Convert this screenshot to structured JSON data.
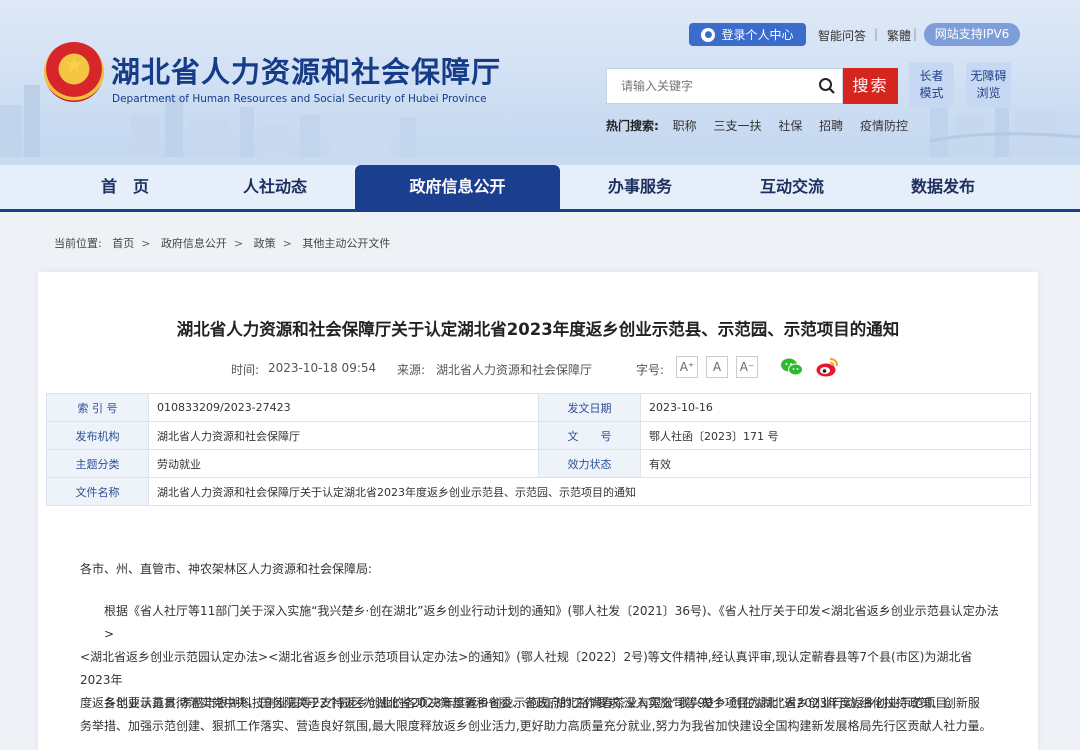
{
  "header": {
    "site_title": "湖北省人力资源和社会保障厅",
    "site_subtitle": "Department of Human Resources and Social Security of Hubei Province",
    "login_label": "登录个人中心",
    "qa_label": "智能问答",
    "trad_label": "繁體",
    "ipv6_label": "网站支持IPV6",
    "search_placeholder": "请输入关键字",
    "search_button": "搜索",
    "elder_mode": [
      "长者",
      "模式"
    ],
    "accessible_mode": [
      "无障碍",
      "浏览"
    ],
    "hot_label": "热门搜索:",
    "hot_terms": [
      "职称",
      "三支一扶",
      "社保",
      "招聘",
      "疫情防控"
    ]
  },
  "nav": {
    "items": [
      "首　页",
      "人社动态",
      "政府信息公开",
      "办事服务",
      "互动交流",
      "数据发布"
    ],
    "active_index": 2
  },
  "breadcrumb": {
    "label": "当前位置:",
    "items": [
      "首页",
      "政府信息公开",
      "政策",
      "其他主动公开文件"
    ]
  },
  "article": {
    "title": "湖北省人力资源和社会保障厅关于认定湖北省2023年度返乡创业示范县、示范园、示范项目的通知",
    "time_label": "时间:",
    "time": "2023-10-18 09:54",
    "source_label": "来源:",
    "source": "湖北省人力资源和社会保障厅",
    "fontsize_label": "字号:",
    "font_buttons": [
      "A⁺",
      "A",
      "A⁻"
    ]
  },
  "info_table": {
    "index_label": "索 引 号",
    "index_value": "010833209/2023-27423",
    "date_label": "发文日期",
    "date_value": "2023-10-16",
    "org_label": "发布机构",
    "org_value": "湖北省人力资源和社会保障厅",
    "docno_label": "文　　号",
    "docno_value": "鄂人社函〔2023〕171 号",
    "topic_label": "主题分类",
    "topic_value": "劳动就业",
    "status_label": "效力状态",
    "status_value": "有效",
    "name_label": "文件名称",
    "name_value": "湖北省人力资源和社会保障厅关于认定湖北省2023年度返乡创业示范县、示范园、示范项目的通知"
  },
  "body": {
    "salutation": "各市、州、直管市、神农架林区人力资源和社会保障局:",
    "p1": [
      "根据《省人社厅等11部门关于深入实施“我兴楚乡·创在湖北”返乡创业行动计划的通知》(鄂人社发〔2021〕36号)、《省人社厅关于印发<湖北省返乡创业示范县认定办法>",
      "<湖北省返乡创业示范园认定办法><湖北省返乡创业示范项目认定办法>的通知》(鄂人社规〔2022〕2号)等文件精神,经认真评审,现认定蕲春县等7个县(市区)为湖北省2023年",
      "度返乡创业示范县,孝感市银湖科技创业园等22个园区为湖北省2023年度返乡创业示范园,湖北裕满春茶业有限公司等90个项目为湖北省2023年度返乡创业示范项目。"
    ],
    "p2": [
      "各地要认真贯彻落实党中央、国务院关于支持返乡创业的各项决策部署和省委、省政府的工作要求,深入实施“我兴楚乡·创在湖北”返乡创业行动,细化扶持政策、创新服",
      "务举措、加强示范创建、狠抓工作落实、营造良好氛围,最大限度释放返乡创业活力,更好助力高质量充分就业,努力为我省加快建设全国构建新发展格局先行区贡献人社力量。"
    ]
  },
  "colors": {
    "brand_blue": "#1b3f8e",
    "search_red": "#d4261f",
    "title_blue": "#163c88"
  }
}
